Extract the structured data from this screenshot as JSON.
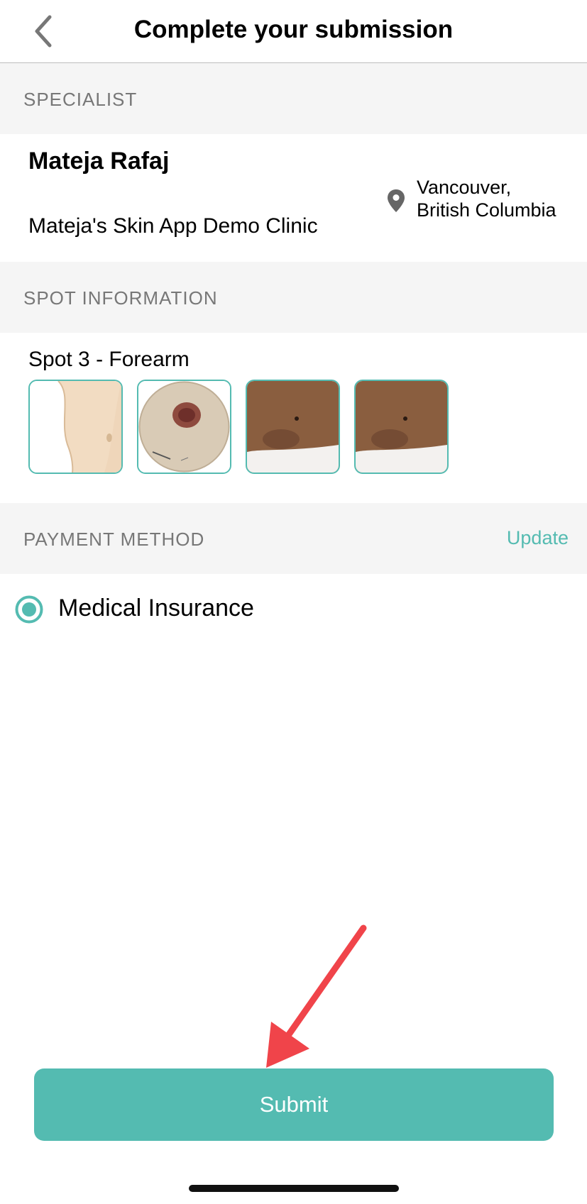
{
  "header": {
    "title": "Complete your submission",
    "back_icon": "chevron-left-icon"
  },
  "specialist_section": {
    "heading": "SPECIALIST",
    "name": "Mateja Rafaj",
    "clinic": "Mateja's Skin App Demo Clinic",
    "location_line1": "Vancouver,",
    "location_line2": "British Columbia",
    "location_icon": "map-pin-icon"
  },
  "spot_section": {
    "heading": "SPOT INFORMATION",
    "spot_title": "Spot 3 - Forearm",
    "photos": [
      {
        "kind": "body-map"
      },
      {
        "kind": "dermoscopy"
      },
      {
        "kind": "overview"
      },
      {
        "kind": "overview"
      }
    ]
  },
  "payment_section": {
    "heading": "PAYMENT METHOD",
    "update_label": "Update",
    "selected_method": "Medical Insurance"
  },
  "submit": {
    "label": "Submit"
  },
  "colors": {
    "accent": "#54bbb1",
    "section_bg": "#f5f5f5",
    "section_text": "#777777",
    "annotation_arrow": "#f0444a"
  }
}
